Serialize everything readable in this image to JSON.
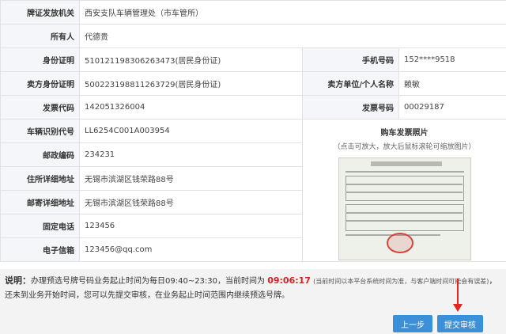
{
  "form": {
    "issuing_authority_label": "牌证发放机关",
    "issuing_authority_value": "西安支队车辆管理处（市车管所）",
    "owner_label": "所有人",
    "owner_value": "代德贵",
    "id_label": "身份证明",
    "id_value": "510121198306263473(居民身份证)",
    "phone_label": "手机号码",
    "phone_value": "152****9518",
    "seller_id_label": "卖方身份证明",
    "seller_id_value": "500223198811263729(居民身份证)",
    "seller_name_label": "卖方单位/个人名称",
    "seller_name_value": "赖敏",
    "invoice_code_label": "发票代码",
    "invoice_code_value": "142051326004",
    "invoice_no_label": "发票号码",
    "invoice_no_value": "00029187",
    "vin_label": "车辆识别代号",
    "vin_value": "LL6254C001A003954",
    "postcode_label": "邮政编码",
    "postcode_value": "234231",
    "address_label": "住所详细地址",
    "address_value": "无锡市滨湖区钱荣路88号",
    "mail_address_label": "邮寄详细地址",
    "mail_address_value": "无锡市滨湖区钱荣路88号",
    "landline_label": "固定电话",
    "landline_value": "123456",
    "email_label": "电子信箱",
    "email_value": "123456@qq.com",
    "photo_title": "购车发票照片",
    "photo_hint": "（点击可放大，放大后鼠标滚轮可缩放图片）"
  },
  "notice": {
    "prefix": "说明：",
    "text1": "办理预选号牌号码业务起止时间为每日09:40~23:30，当前时间为",
    "current_time": "09:06:17",
    "small_note": "(当前时间以本平台系统时间为准，与客户端时间可能会有误差)",
    "text2": "，还未到业务开始时间，您可以先提交审核，在业务起止时间范围内继续预选号牌。"
  },
  "buttons": {
    "prev_label": "上一步",
    "submit_label": "提交审核"
  },
  "colors": {
    "button_blue": "#3d8fd8",
    "highlight_red": "#e02020",
    "label_bg": "#f4f6f9",
    "border": "#dfe3e8"
  }
}
